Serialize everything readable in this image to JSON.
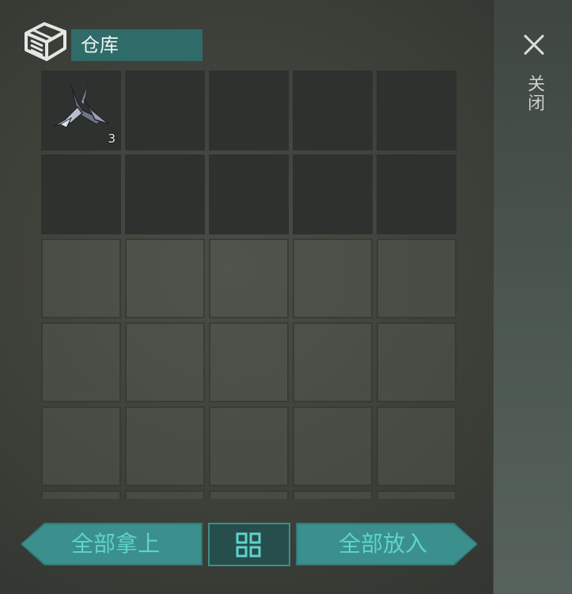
{
  "window": {
    "title": "仓库"
  },
  "close": {
    "label": "关闭",
    "icon": "close-icon"
  },
  "storage": {
    "icon": "storage-box-icon",
    "slots": [
      {
        "item": "metal-shard-icon",
        "count": "3"
      },
      {
        "item": null,
        "count": ""
      },
      {
        "item": null,
        "count": ""
      },
      {
        "item": null,
        "count": ""
      },
      {
        "item": null,
        "count": ""
      },
      {
        "item": null,
        "count": ""
      },
      {
        "item": null,
        "count": ""
      },
      {
        "item": null,
        "count": ""
      },
      {
        "item": null,
        "count": ""
      },
      {
        "item": null,
        "count": ""
      }
    ],
    "unlocked_slots": 10,
    "total_visible_slots": 30
  },
  "actions": {
    "take_all_label": "全部拿上",
    "put_all_label": "全部放入",
    "sort_icon": "sort-grid-icon"
  },
  "colors": {
    "accent": "#3b8f8c",
    "accent_text": "#5fd3cd",
    "title_bg": "#2f6b68"
  }
}
